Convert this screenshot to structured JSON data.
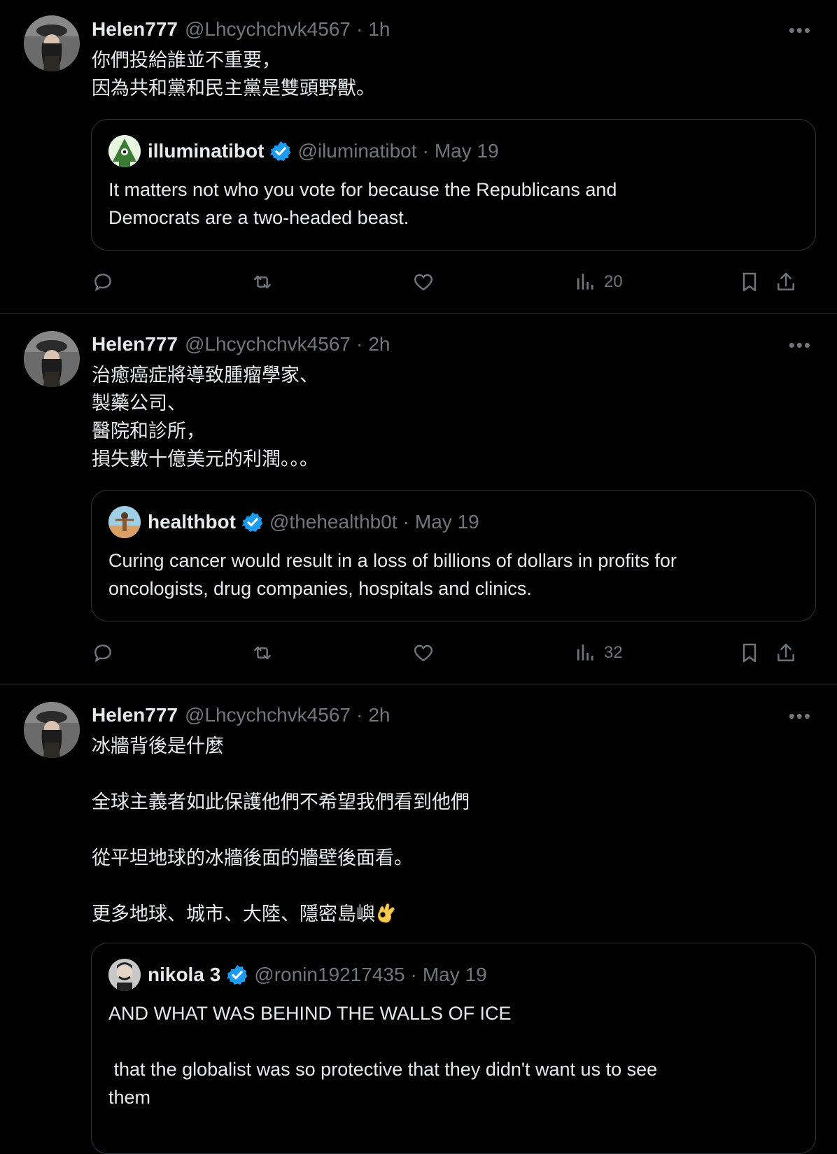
{
  "colors": {
    "background": "#000000",
    "text": "#e7e9ea",
    "muted": "#71767b",
    "border": "#2f3336",
    "verified": "#1d9bf0"
  },
  "tweets": [
    {
      "author": {
        "name": "Helen777",
        "handle": "@Lhcychchvk4567"
      },
      "time": "1h",
      "more": "•••",
      "text": "你們投給誰並不重要，\n因為共和黨和民主黨是雙頭野獸。",
      "quote": {
        "name": "illuminatibot",
        "handle": "@iluminatibot",
        "date": "May 19",
        "text": "It matters not who you vote for because the Republicans and\nDemocrats are a two-headed beast."
      },
      "views": "20"
    },
    {
      "author": {
        "name": "Helen777",
        "handle": "@Lhcychchvk4567"
      },
      "time": "2h",
      "more": "•••",
      "text": "治癒癌症將導致腫瘤學家、\n製藥公司、\n醫院和診所，\n損失數十億美元的利潤。。。",
      "quote": {
        "name": "healthbot",
        "handle": "@thehealthb0t",
        "date": "May 19",
        "text": "Curing cancer would result in a loss of billions of dollars in profits for\noncologists, drug companies, hospitals and clinics."
      },
      "views": "32"
    },
    {
      "author": {
        "name": "Helen777",
        "handle": "@Lhcychchvk4567"
      },
      "time": "2h",
      "more": "•••",
      "text": "冰牆背後是什麼\n\n全球主義者如此保護他們不希望我們看到他們\n\n從平坦地球的冰牆後面的牆壁後面看。\n\n更多地球、城市、大陸、隱密島嶼",
      "emoji": "ok-hand-emoji",
      "quote": {
        "name": "nikola 3",
        "handle": "@ronin19217435",
        "date": "May 19",
        "text": "AND WHAT WAS BEHIND THE WALLS OF ICE\n\n that the globalist was so protective that they didn't want us to see\nthem"
      }
    }
  ],
  "separator": "·"
}
